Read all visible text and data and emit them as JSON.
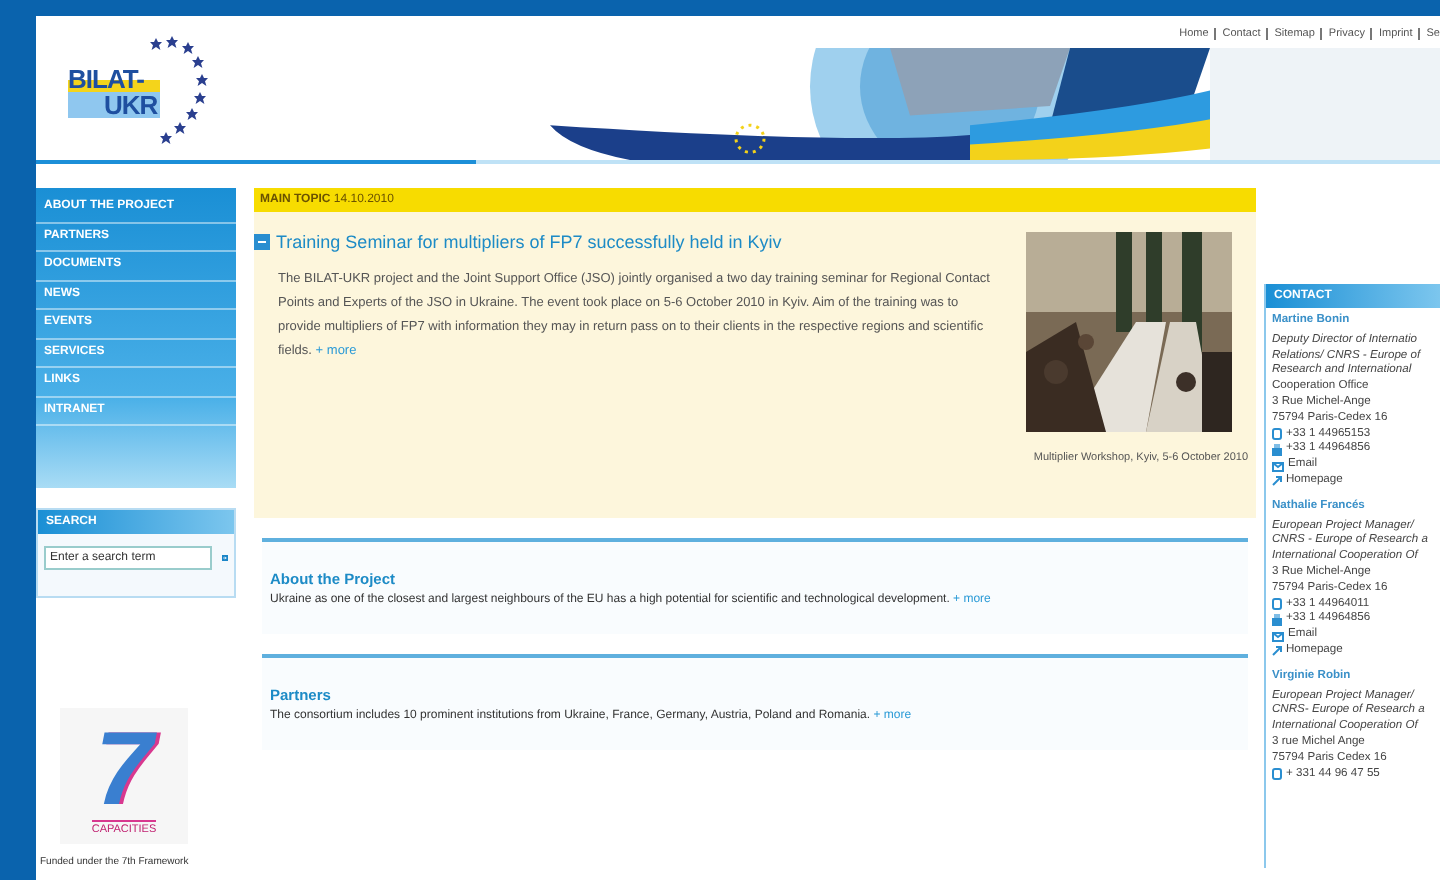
{
  "header": {
    "logo": {
      "line1": "BILAT-",
      "line2": "UKR"
    },
    "top_links": [
      "Home",
      "Contact",
      "Sitemap",
      "Privacy",
      "Imprint",
      "Se"
    ]
  },
  "nav": {
    "items": [
      "ABOUT THE PROJECT",
      "PARTNERS",
      "DOCUMENTS",
      "NEWS",
      "EVENTS",
      "SERVICES",
      "LINKS",
      "INTRANET"
    ]
  },
  "search": {
    "title": "SEARCH",
    "placeholder": "Enter a search term"
  },
  "funding": {
    "mark": "7",
    "label": "CAPACITIES",
    "text": "Funded under the 7th Framework"
  },
  "main_topic": {
    "label": "**MAIN TOPIC** 14.10.2010",
    "title": "Training Seminar for multipliers of FP7 successfully held in Kyiv",
    "body": "The BILAT-UKR project and the Joint Support Office (JSO) jointly organised a two day training seminar for Regional Contact Points and Experts of the JSO in Ukraine. The event took place on 5-6 October 2010 in Kyiv. Aim of the training was to provide multipliers of FP7 with information they may in return pass on to their clients in the respective regions and scientific fields.",
    "more": "+ more",
    "caption": "Multiplier Workshop, Kyiv, 5-6 October 2010"
  },
  "sections": [
    {
      "title": "About the Project",
      "body": "Ukraine as one of the closest and largest neighbours of the EU has a high potential for scientific and technological development.",
      "more": "+ more"
    },
    {
      "title": "Partners",
      "body": "The consortium includes 10 prominent institutions from Ukraine, France, Germany, Austria, Poland and Romania.",
      "more": "+ more"
    }
  ],
  "contact": {
    "title": "CONTACT",
    "people": [
      {
        "name": "Martine Bonin",
        "lines": [
          {
            "kind": "role",
            "text": "Deputy Director of Internatio"
          },
          {
            "kind": "role",
            "text": "Relations/ CNRS - Europe of"
          },
          {
            "kind": "role",
            "text": "Research and International"
          },
          {
            "kind": "address",
            "text": "Cooperation Office"
          },
          {
            "kind": "address",
            "text": "3 Rue Michel-Ange"
          },
          {
            "kind": "address",
            "text": "75794 Paris-Cedex 16"
          },
          {
            "kind": "phone",
            "text": "+33 1 44965153"
          },
          {
            "kind": "fax",
            "text": "+33 1 44964856"
          },
          {
            "kind": "email",
            "text": "Email"
          },
          {
            "kind": "homepage",
            "text": "Homepage"
          }
        ]
      },
      {
        "name": "Nathalie Francés",
        "lines": [
          {
            "kind": "role",
            "text": "European Project Manager/"
          },
          {
            "kind": "role",
            "text": "CNRS - Europe of Research a"
          },
          {
            "kind": "role",
            "text": "International Cooperation Of"
          },
          {
            "kind": "address",
            "text": "3 Rue Michel-Ange"
          },
          {
            "kind": "address",
            "text": "75794 Paris-Cedex 16"
          },
          {
            "kind": "phone",
            "text": "+33 1 44964011"
          },
          {
            "kind": "fax",
            "text": "+33 1 44964856"
          },
          {
            "kind": "email",
            "text": "Email"
          },
          {
            "kind": "homepage",
            "text": "Homepage"
          }
        ]
      },
      {
        "name": "Virginie Robin",
        "lines": [
          {
            "kind": "role",
            "text": "European Project Manager/"
          },
          {
            "kind": "role",
            "text": "CNRS- Europe of Research a"
          },
          {
            "kind": "role",
            "text": "International Cooperation Of"
          },
          {
            "kind": "address",
            "text": "3 rue Michel Ange"
          },
          {
            "kind": "address",
            "text": "75794 Paris Cedex 16"
          },
          {
            "kind": "phone",
            "text": "+ 331 44 96 47 55"
          }
        ]
      }
    ]
  }
}
